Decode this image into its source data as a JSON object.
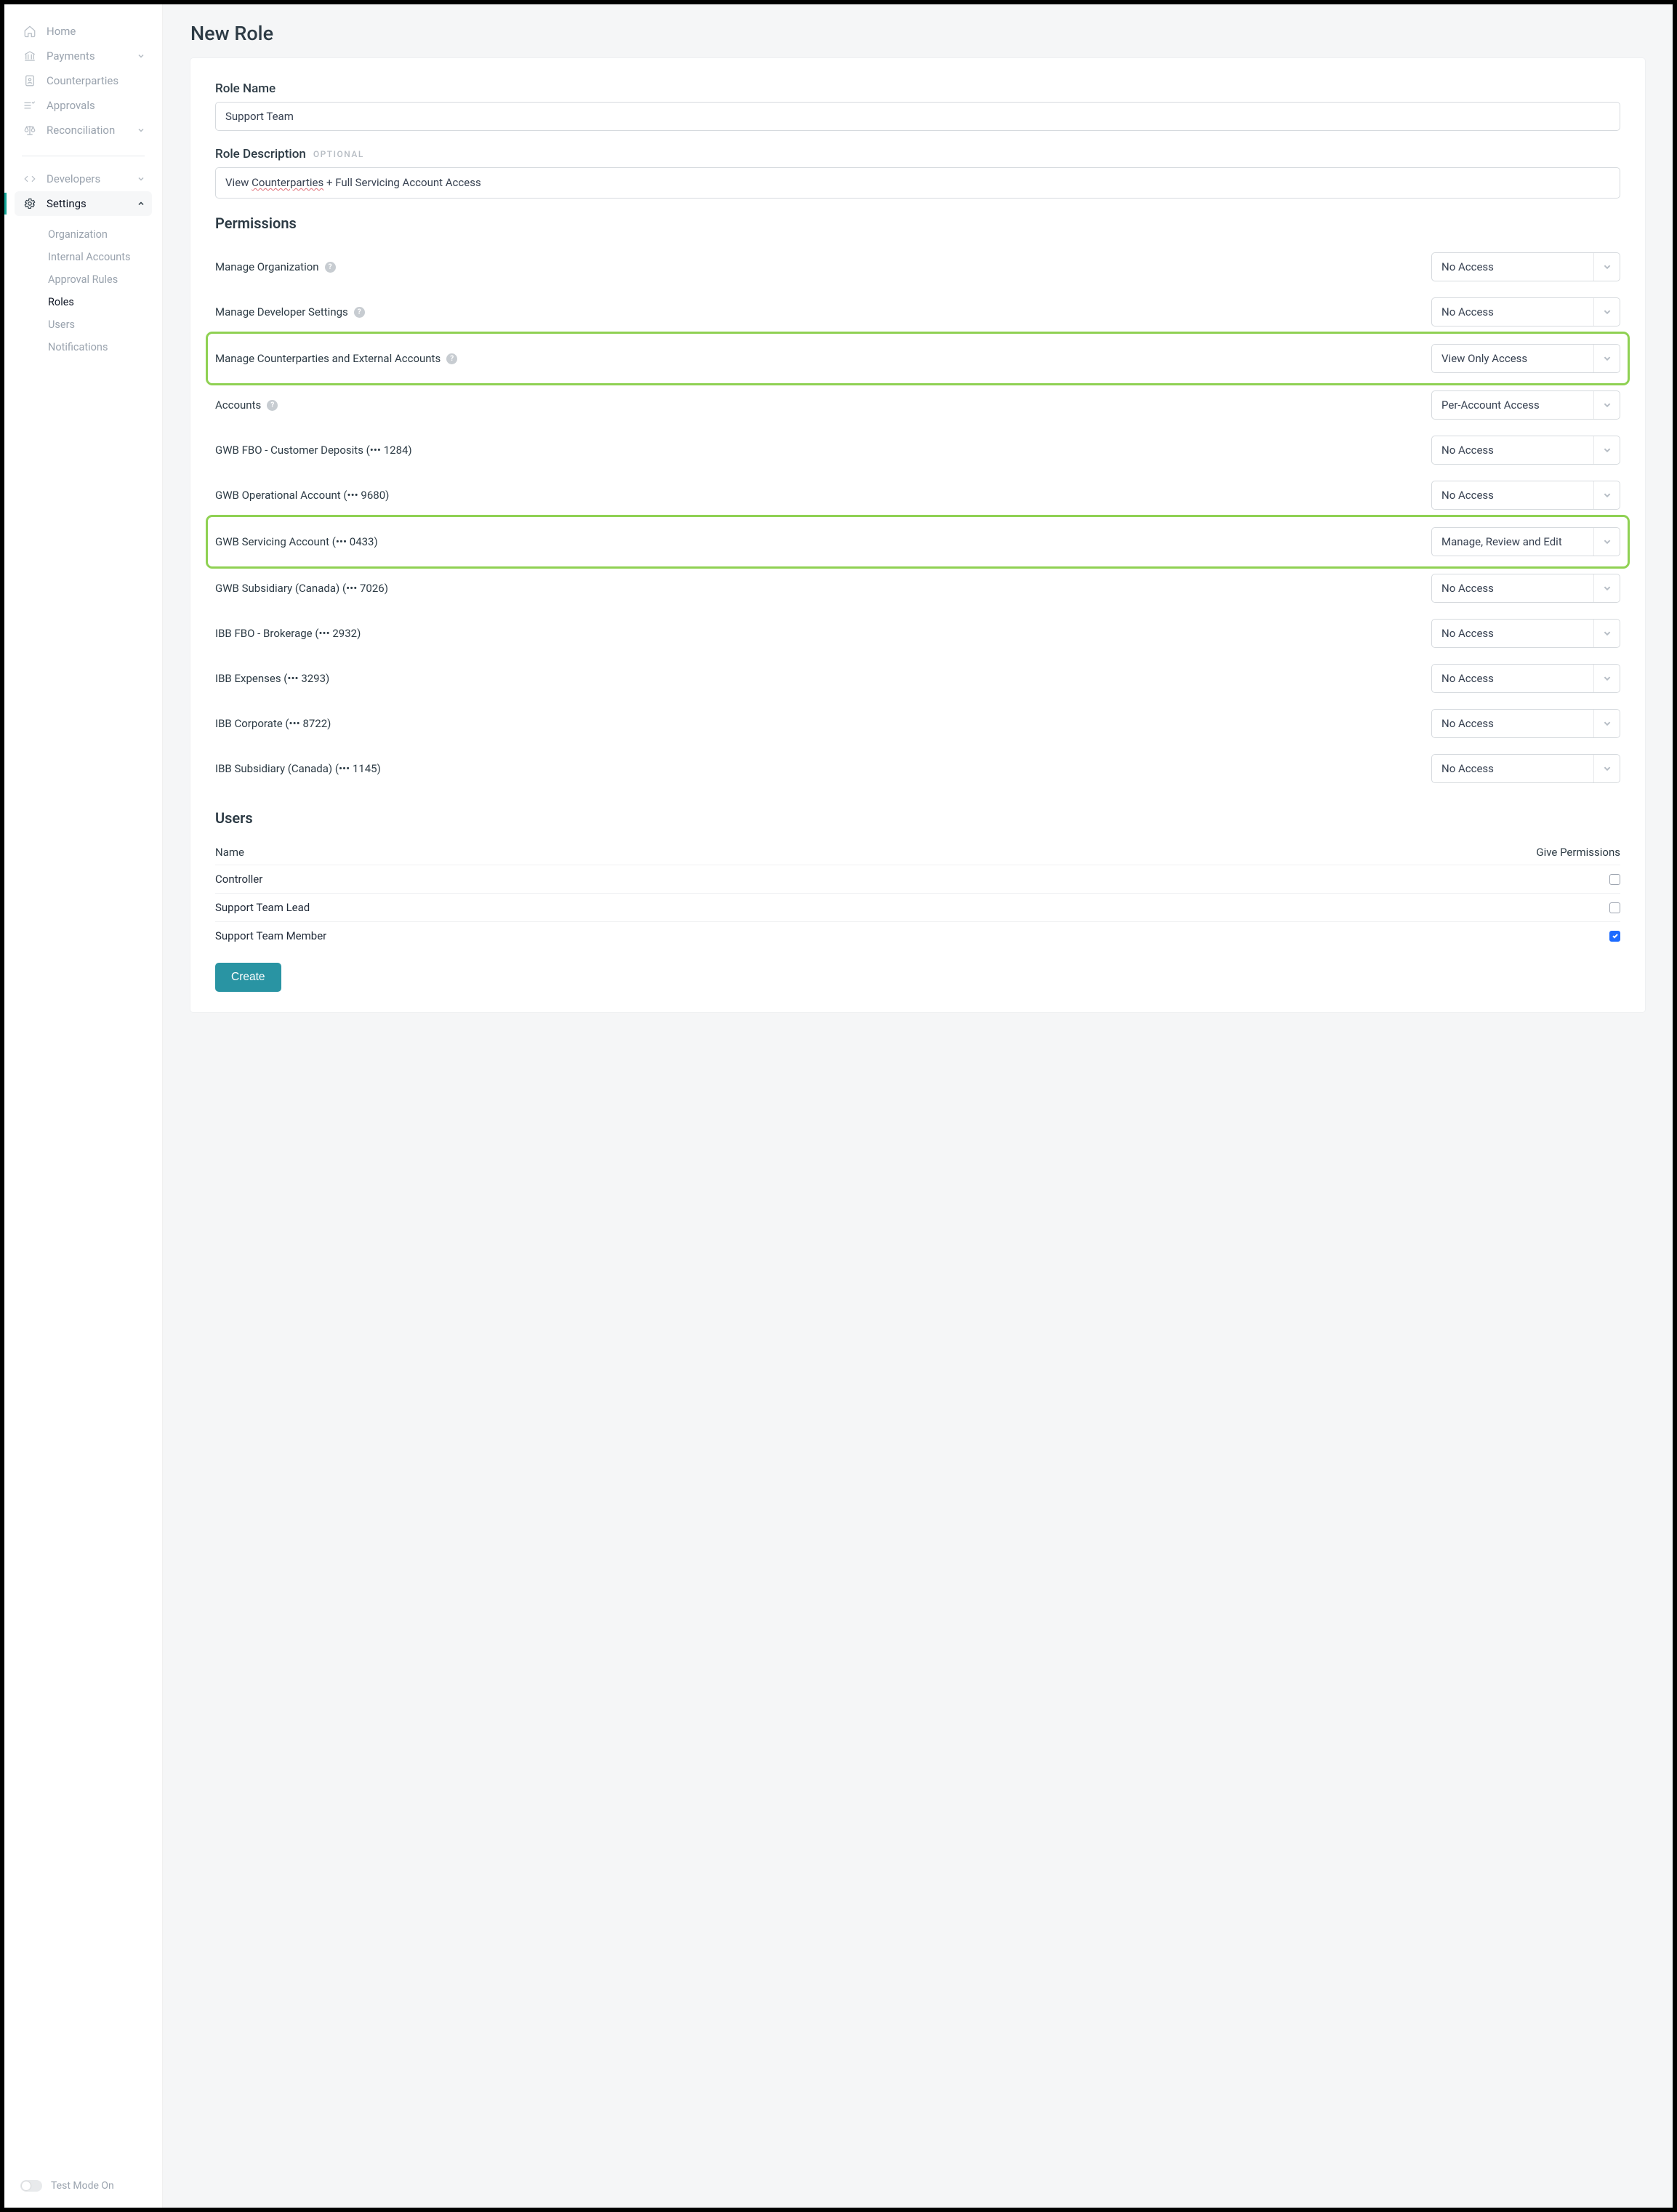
{
  "sidebar": {
    "items": [
      {
        "label": "Home",
        "icon": "home-icon",
        "expandable": false
      },
      {
        "label": "Payments",
        "icon": "bank-icon",
        "expandable": true
      },
      {
        "label": "Counterparties",
        "icon": "contacts-icon",
        "expandable": false
      },
      {
        "label": "Approvals",
        "icon": "approvals-icon",
        "expandable": false
      },
      {
        "label": "Reconciliation",
        "icon": "scales-icon",
        "expandable": true
      }
    ],
    "dev_label": "Developers",
    "settings_label": "Settings",
    "subitems": [
      {
        "label": "Organization"
      },
      {
        "label": "Internal Accounts"
      },
      {
        "label": "Approval Rules"
      },
      {
        "label": "Roles"
      },
      {
        "label": "Users"
      },
      {
        "label": "Notifications"
      }
    ],
    "footer_label": "Test Mode On"
  },
  "page": {
    "title": "New Role",
    "role_name_label": "Role Name",
    "role_name_value": "Support Team",
    "role_desc_label": "Role Description",
    "optional": "OPTIONAL",
    "role_desc_prefix": "View ",
    "role_desc_underlined": "Counterparties",
    "role_desc_suffix": " + Full Servicing Account Access",
    "permissions_title": "Permissions",
    "users_title": "Users",
    "users_name_col": "Name",
    "users_perm_col": "Give Permissions",
    "create_label": "Create"
  },
  "permissions": [
    {
      "label": "Manage Organization",
      "help": true,
      "value": "No Access",
      "highlight": false
    },
    {
      "label": "Manage Developer Settings",
      "help": true,
      "value": "No Access",
      "highlight": false
    },
    {
      "label": "Manage Counterparties and External Accounts",
      "help": true,
      "value": "View Only Access",
      "highlight": true
    },
    {
      "label": "Accounts",
      "help": true,
      "value": "Per-Account Access",
      "highlight": false
    },
    {
      "label": "GWB FBO - Customer Deposits (••• 1284)",
      "help": false,
      "value": "No Access",
      "highlight": false
    },
    {
      "label": "GWB Operational Account (••• 9680)",
      "help": false,
      "value": "No Access",
      "highlight": false
    },
    {
      "label": "GWB Servicing Account (••• 0433)",
      "help": false,
      "value": "Manage, Review and Edit",
      "highlight": true
    },
    {
      "label": "GWB Subsidiary (Canada) (••• 7026)",
      "help": false,
      "value": "No Access",
      "highlight": false
    },
    {
      "label": "IBB FBO - Brokerage (••• 2932)",
      "help": false,
      "value": "No Access",
      "highlight": false
    },
    {
      "label": "IBB Expenses (••• 3293)",
      "help": false,
      "value": "No Access",
      "highlight": false
    },
    {
      "label": "IBB Corporate (••• 8722)",
      "help": false,
      "value": "No Access",
      "highlight": false
    },
    {
      "label": "IBB Subsidiary (Canada) (••• 1145)",
      "help": false,
      "value": "No Access",
      "highlight": false
    }
  ],
  "users": [
    {
      "name": "Controller",
      "checked": false
    },
    {
      "name": "Support Team Lead",
      "checked": false
    },
    {
      "name": "Support Team Member",
      "checked": true
    }
  ]
}
